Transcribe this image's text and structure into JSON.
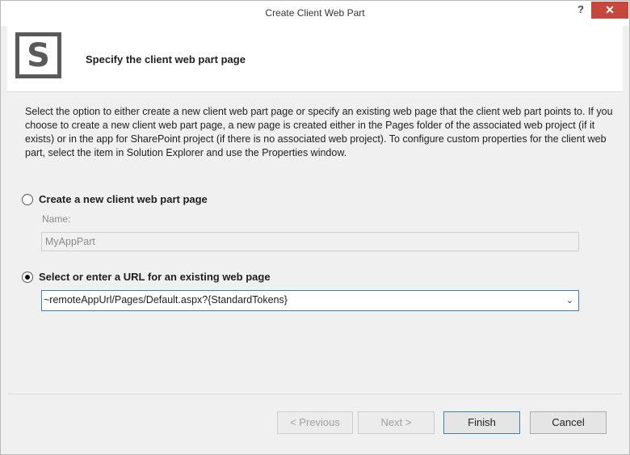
{
  "window": {
    "title": "Create Client Web Part",
    "help_label": "?",
    "close_label": "✕"
  },
  "header": {
    "logo_letter": "S",
    "title": "Specify the client web part page"
  },
  "main": {
    "description": "Select the option to either create a new client web part page or specify an existing web page that the client web part points to. If you choose to create a new client web part page, a new page is created either in the Pages folder of the associated web project (if it exists) or in the app for SharePoint project (if there is no associated web project). To configure custom properties for the client web part, select the item in Solution Explorer and use the Properties window.",
    "option_new": {
      "label": "Create a new client web part page",
      "selected": false,
      "name_label": "Name:",
      "name_value": "MyAppPart"
    },
    "option_existing": {
      "label": "Select or enter a URL for an existing web page",
      "selected": true,
      "url_value": "~remoteAppUrl/Pages/Default.aspx?{StandardTokens}"
    }
  },
  "footer": {
    "previous_label": "< Previous",
    "next_label": "Next >",
    "finish_label": "Finish",
    "cancel_label": "Cancel"
  },
  "icons": {
    "logo": "sharepoint-logo-icon",
    "dropdown": "chevron-down-icon"
  }
}
